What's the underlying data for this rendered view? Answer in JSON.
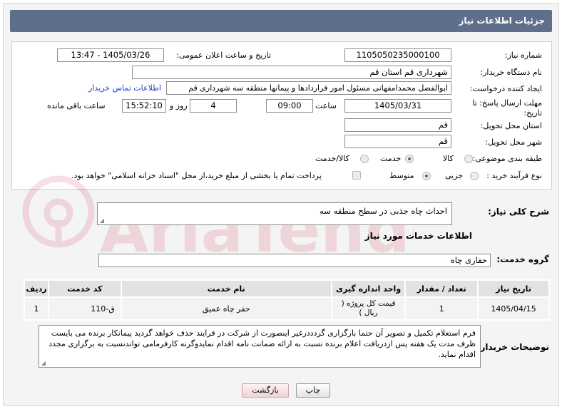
{
  "header": {
    "title": "جزئیات اطلاعات نیاز"
  },
  "fields": {
    "need_number_label": "شماره نیاز:",
    "need_number": "1105050235000100",
    "announce_label": "تاریخ و ساعت اعلان عمومی:",
    "announce_value": "1405/03/26 - 13:47",
    "buyer_org_label": "نام دستگاه خریدار:",
    "buyer_org": "شهرداری قم استان قم",
    "creator_label": "ایجاد کننده درخواست:",
    "creator": "ابوالفضل محمدامفهانی مسئول امور قراردادها و پیمانها منطقه سه شهرداری قم",
    "contact_link": "اطلاعات تماس خریدار",
    "deadline_label_1": "مهلت ارسال پاسخ: تا",
    "deadline_label_2": "تاریخ:",
    "deadline_date": "1405/03/31",
    "time_label": "ساعت",
    "deadline_time": "09:00",
    "days_value": "4",
    "days_label": "روز و",
    "remaining_time": "15:52:10",
    "remaining_label": "ساعت باقی مانده",
    "province_label": "استان محل تحویل:",
    "province": "قم",
    "city_label": "شهر محل تحویل:",
    "city": "قم",
    "category_label": "طبقه بندی موضوعی:",
    "category_options": [
      "کالا",
      "خدمت",
      "کالا/خدمت"
    ],
    "purchase_label": "نوع فرآیند خرید :",
    "purchase_options": [
      "جزیی",
      "متوسط"
    ],
    "payment_note": "پرداخت تمام یا بخشی از مبلغ خرید،از محل \"اسناد خزانه اسلامی\" خواهد بود."
  },
  "summary": {
    "label": "شرح کلی نیاز:",
    "text": "احداث چاه جذبی در سطح منطقه سه"
  },
  "services": {
    "section_title": "اطلاعات خدمات مورد نیاز",
    "group_label": "گروه خدمت:",
    "group_value": "حفاری چاه",
    "columns": [
      "ردیف",
      "کد خدمت",
      "نام خدمت",
      "واحد اندازه گیری",
      "تعداد / مقدار",
      "تاریخ نیاز"
    ],
    "rows": [
      {
        "row": "1",
        "code": "ق-110",
        "name": "حفر چاه عمیق",
        "unit": "قیمت کل پروژه ( ریال )",
        "qty": "1",
        "date": "1405/04/15"
      }
    ]
  },
  "notes": {
    "label": "توضیحات خریدار:",
    "text": "فرم استعلام تکمیل و تصویر آن حتما بارگزاری گردددرغیر اینصورت از شرکت در فرایند حذف خواهد گردید پیمانکار برنده می بایست ظرف مدت یک هفته پس ازدریافت اعلام برنده نسبت به ارائه ضمانت نامه اقدام نمایدوگرنه کارفرمامی تواندنسبت به برگزاری مجدد اقدام نماید."
  },
  "buttons": {
    "print": "چاپ",
    "back": "بازگشت"
  },
  "watermark": {
    "text": "AriaTender.net"
  },
  "colors": {
    "header_bg": "#5f6e8a",
    "link": "#1a3fbf",
    "watermark": "#c8102e"
  }
}
